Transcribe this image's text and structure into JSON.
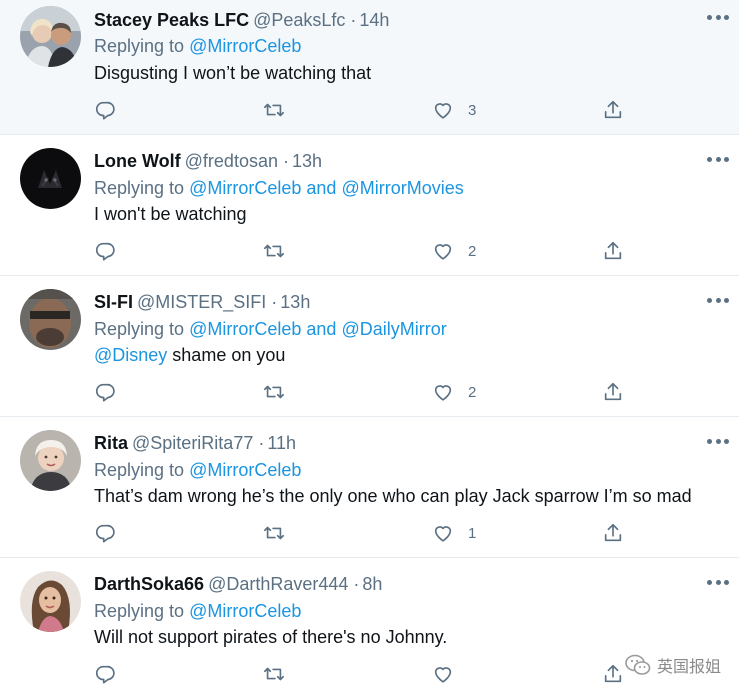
{
  "tweets": [
    {
      "name": "Stacey Peaks LFC",
      "handle": "@PeaksLfc",
      "dot": "·",
      "time": "14h",
      "replying_prefix": "Replying to",
      "mentions": [
        "@MirrorCeleb"
      ],
      "connector": "",
      "text_mention": "",
      "text": "Disgusting I won’t be watching  that",
      "likes": "3"
    },
    {
      "name": "Lone Wolf",
      "handle": "@fredtosan",
      "dot": "·",
      "time": "13h",
      "replying_prefix": "Replying to",
      "mentions": [
        "@MirrorCeleb",
        "@MirrorMovies"
      ],
      "connector": "and",
      "text_mention": "",
      "text": "I won't be watching",
      "likes": "2"
    },
    {
      "name": "SI-FI",
      "handle": "@MISTER_SIFI",
      "dot": "·",
      "time": "13h",
      "replying_prefix": "Replying to",
      "mentions": [
        "@MirrorCeleb",
        "@DailyMirror"
      ],
      "connector": "and",
      "text_mention": "@Disney",
      "text": " shame on you",
      "likes": "2"
    },
    {
      "name": "Rita",
      "handle": "@SpiteriRita77",
      "dot": "·",
      "time": "11h",
      "replying_prefix": "Replying to",
      "mentions": [
        "@MirrorCeleb"
      ],
      "connector": "",
      "text_mention": "",
      "text": "That’s dam wrong he’s the only one who can play Jack sparrow I’m so mad",
      "likes": "1"
    },
    {
      "name": "DarthSoka66",
      "handle": "@DarthRaver444",
      "dot": "·",
      "time": "8h",
      "replying_prefix": "Replying to",
      "mentions": [
        "@MirrorCeleb"
      ],
      "connector": "",
      "text_mention": "",
      "text": "Will not support pirates of there's no Johnny.",
      "likes": ""
    }
  ],
  "watermark": "英国报姐",
  "icons": {
    "reply": "reply-icon",
    "retweet": "retweet-icon",
    "like": "heart-icon",
    "share": "share-icon",
    "more": "more-icon"
  },
  "colors": {
    "link": "#1b95e0",
    "muted": "#5b7083",
    "highlight_bg": "#f5f8fa",
    "divider": "#e6ecf0"
  }
}
